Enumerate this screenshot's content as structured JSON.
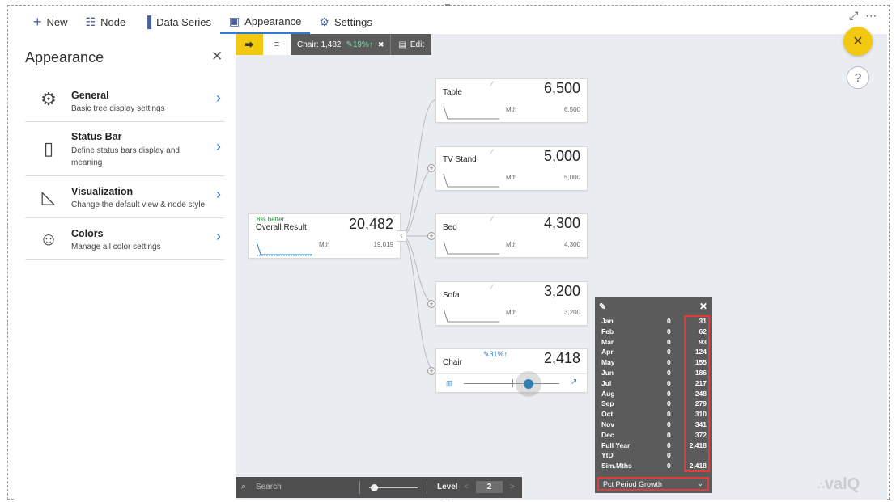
{
  "menu": {
    "items": [
      {
        "icon": "plus-icon",
        "glyph": "+",
        "label": "New"
      },
      {
        "icon": "node-icon",
        "glyph": "☷",
        "label": "Node"
      },
      {
        "icon": "data-series-icon",
        "glyph": "▐",
        "label": "Data Series"
      },
      {
        "icon": "appearance-icon",
        "glyph": "▣",
        "label": "Appearance"
      },
      {
        "icon": "settings-icon",
        "glyph": "⚙",
        "label": "Settings"
      }
    ],
    "active": "Appearance",
    "focus_mode_glyph": "⤢",
    "more_glyph": "⋯"
  },
  "panel": {
    "title": "Appearance",
    "close_glyph": "✕",
    "items": [
      {
        "title": "General",
        "desc": "Basic tree display settings",
        "icon": "gear-icon",
        "glyph": "⚙"
      },
      {
        "title": "Status Bar",
        "desc": "Define status bars display and meaning",
        "icon": "status-bar-icon",
        "glyph": "▯"
      },
      {
        "title": "Visualization",
        "desc": "Change the default view & node style",
        "icon": "ruler-triangle-icon",
        "glyph": "◺"
      },
      {
        "title": "Colors",
        "desc": "Manage all color settings",
        "icon": "palette-icon",
        "glyph": "☺"
      }
    ],
    "chevron": "›"
  },
  "toolbar": {
    "tree_glyph": "⮕",
    "list_glyph": "≡",
    "status_label": "Chair: 1,482",
    "status_change": "✎19%↑",
    "trash_glyph": "🗑",
    "edit_label": "Edit"
  },
  "root": {
    "badge": "8% better",
    "label": "Overall Result",
    "value": "20,482",
    "period": "Mth",
    "sub_value": "19,019"
  },
  "children": [
    {
      "label": "Table",
      "value": "6,500",
      "period": "Mth",
      "sub_value": "6,500"
    },
    {
      "label": "TV Stand",
      "value": "5,000",
      "period": "Mth",
      "sub_value": "5,000"
    },
    {
      "label": "Bed",
      "value": "4,300",
      "period": "Mth",
      "sub_value": "4,300"
    },
    {
      "label": "Sofa",
      "value": "3,200",
      "period": "Mth",
      "sub_value": "3,200"
    }
  ],
  "chair": {
    "label": "Chair",
    "value": "2,418",
    "change": "✎31%↑",
    "slider_value": 0.68
  },
  "popup": {
    "rows": [
      {
        "m": "Jan",
        "z": "0",
        "v": "31"
      },
      {
        "m": "Feb",
        "z": "0",
        "v": "62"
      },
      {
        "m": "Mar",
        "z": "0",
        "v": "93"
      },
      {
        "m": "Apr",
        "z": "0",
        "v": "124"
      },
      {
        "m": "May",
        "z": "0",
        "v": "155"
      },
      {
        "m": "Jun",
        "z": "0",
        "v": "186"
      },
      {
        "m": "Jul",
        "z": "0",
        "v": "217"
      },
      {
        "m": "Aug",
        "z": "0",
        "v": "248"
      },
      {
        "m": "Sep",
        "z": "0",
        "v": "279"
      },
      {
        "m": "Oct",
        "z": "0",
        "v": "310"
      },
      {
        "m": "Nov",
        "z": "0",
        "v": "341"
      },
      {
        "m": "Dec",
        "z": "0",
        "v": "372"
      },
      {
        "m": "Full Year",
        "z": "0",
        "v": "2,418"
      },
      {
        "m": "YtD",
        "z": "0",
        "v": ""
      },
      {
        "m": "Sim.Mths",
        "z": "0",
        "v": "2,418"
      }
    ],
    "dropdown_value": "Pct Period Growth",
    "close_glyph": "✕"
  },
  "bottombar": {
    "search_placeholder": "Search",
    "level_label": "Level",
    "level_value": "2",
    "prev_glyph": "<",
    "next_glyph": ">",
    "zoom_value": 0.1
  },
  "fab": {
    "close_glyph": "✕",
    "help_glyph": "?"
  },
  "logo": "valQ",
  "colors": {
    "accent": "#f2c811",
    "active_tab": "#2b7cd3",
    "highlight": "#e03c3c",
    "popup_bg": "#5b5b5b",
    "slider": "#2f7fb6"
  }
}
